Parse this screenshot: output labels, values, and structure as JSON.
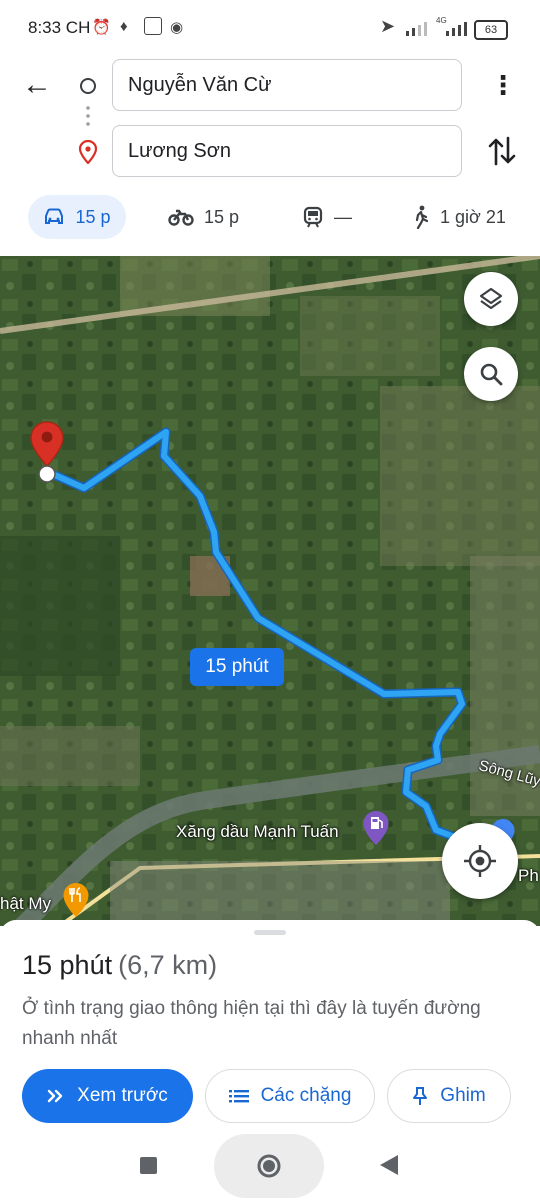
{
  "status_bar": {
    "time": "8:33 CH",
    "battery": "63",
    "network": "4G"
  },
  "header": {
    "origin": "Nguyễn Văn Cừ",
    "destination": "Lương Sơn"
  },
  "modes": [
    {
      "name": "car",
      "value": "15 p",
      "icon": "car-icon"
    },
    {
      "name": "motorbike",
      "value": "15 p",
      "icon": "motorbike-icon"
    },
    {
      "name": "transit",
      "value": "—",
      "icon": "train-icon"
    },
    {
      "name": "walk",
      "value": "1 giờ 21",
      "icon": "walk-icon"
    }
  ],
  "map": {
    "route_label": "15 phút",
    "river_label": "Sông Lũy",
    "poi_gas": "Xăng dầu Mạnh Tuấn",
    "poi_food": "hật My",
    "poi_edge": "Ph",
    "route_color": "#2fa4f3",
    "pin_color": "#d93025"
  },
  "sheet": {
    "duration": "15 phút",
    "distance": "(6,7 km)",
    "description": "Ở tình trạng giao thông hiện tại thì đây là tuyến đường nhanh nhất",
    "preview_label": "Xem trước",
    "steps_label": "Các chặng",
    "pin_label": "Ghim"
  },
  "colors": {
    "accent": "#1a73e8",
    "active_tab_bg": "#e8f0fe"
  }
}
